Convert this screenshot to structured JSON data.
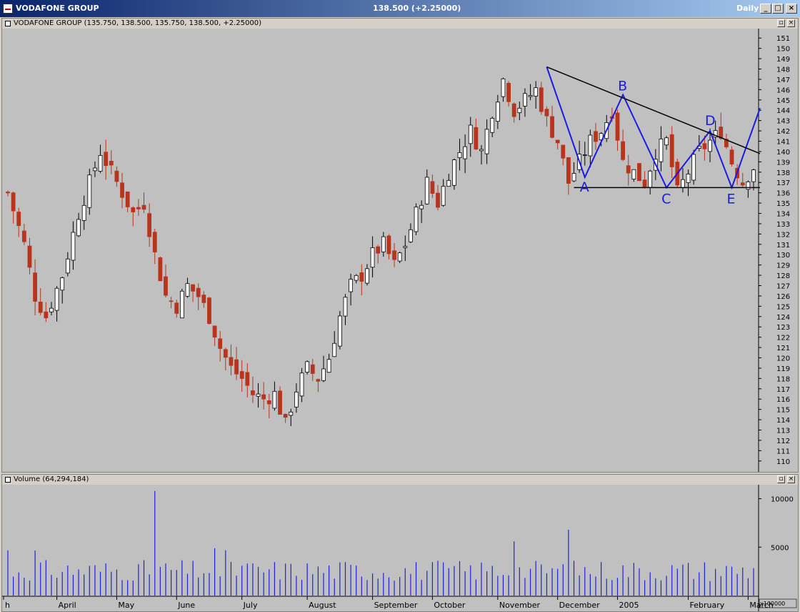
{
  "window": {
    "title": "VODAFONE GROUP",
    "quote": "138.500 (+2.25000)",
    "period": "Daily"
  },
  "price_pane": {
    "title": "VODAFONE GROUP (135.750, 138.500, 135.750, 138.500, +2.25000)"
  },
  "volume_pane": {
    "title": "Volume (64,294,184)",
    "multiplier": "x100000"
  },
  "chart_data": {
    "type": "candlestick",
    "y_axis_ticks": [
      "151",
      "150",
      "149",
      "148",
      "147",
      "146",
      "145",
      "144",
      "143",
      "142",
      "141",
      "140",
      "139",
      "138",
      "137",
      "136",
      "135",
      "134",
      "133",
      "132",
      "131",
      "130",
      "129",
      "128",
      "127",
      "126",
      "125",
      "124",
      "123",
      "122",
      "121",
      "120",
      "119",
      "118",
      "117",
      "116",
      "115",
      "114",
      "113",
      "112",
      "111",
      "110"
    ],
    "ylim": [
      109.5,
      151.5
    ],
    "month_labels": [
      "h",
      "April",
      "May",
      "June",
      "July",
      "August",
      "September",
      "October",
      "November",
      "December",
      "2005",
      "February",
      "March"
    ],
    "close_trend": [
      [
        0,
        136
      ],
      [
        3,
        131
      ],
      [
        5,
        126
      ],
      [
        7,
        124
      ],
      [
        10,
        128
      ],
      [
        13,
        134
      ],
      [
        15,
        137
      ],
      [
        17,
        140
      ],
      [
        19,
        138
      ],
      [
        21,
        136
      ],
      [
        23,
        134
      ],
      [
        25,
        135
      ],
      [
        27,
        130
      ],
      [
        29,
        126
      ],
      [
        31,
        125
      ],
      [
        33,
        127
      ],
      [
        35,
        126
      ],
      [
        37,
        124
      ],
      [
        39,
        121
      ],
      [
        41,
        119
      ],
      [
        43,
        118
      ],
      [
        45,
        116.5
      ],
      [
        47,
        116
      ],
      [
        49,
        116.5
      ],
      [
        51,
        113.5
      ],
      [
        53,
        117
      ],
      [
        55,
        119
      ],
      [
        57,
        118
      ],
      [
        59,
        120
      ],
      [
        61,
        124
      ],
      [
        63,
        127
      ],
      [
        65,
        128
      ],
      [
        67,
        130
      ],
      [
        69,
        131
      ],
      [
        71,
        129
      ],
      [
        73,
        131
      ],
      [
        75,
        134
      ],
      [
        77,
        137
      ],
      [
        79,
        135
      ],
      [
        81,
        138
      ],
      [
        83,
        140
      ],
      [
        85,
        142
      ],
      [
        87,
        140
      ],
      [
        89,
        144
      ],
      [
        91,
        147
      ],
      [
        93,
        144
      ],
      [
        95,
        145
      ],
      [
        97,
        146
      ],
      [
        99,
        143
      ],
      [
        101,
        141
      ],
      [
        103,
        137
      ],
      [
        105,
        139
      ],
      [
        107,
        141
      ],
      [
        109,
        142
      ],
      [
        111,
        144
      ],
      [
        113,
        139
      ],
      [
        115,
        138
      ],
      [
        117,
        137
      ],
      [
        119,
        140
      ],
      [
        121,
        141
      ],
      [
        123,
        136
      ],
      [
        125,
        138
      ],
      [
        127,
        140
      ],
      [
        129,
        141
      ],
      [
        131,
        142
      ],
      [
        133,
        139
      ],
      [
        135,
        137
      ],
      [
        137,
        138.5
      ]
    ],
    "pattern_points": {
      "A": 137.5,
      "B": 145.5,
      "C": 136.5,
      "D": 142,
      "E": 136.5
    },
    "pattern_labels": [
      "A",
      "B",
      "C",
      "D",
      "E"
    ],
    "volume_axis_ticks": [
      "10000",
      "5000"
    ],
    "volume_ylim": [
      0,
      11000
    ]
  },
  "colors": {
    "background": "#c0c0c0",
    "up_candle": "#ffffff",
    "down_candle": "#b8341c",
    "outline": "#000000",
    "pattern_line": "#1a1ae6",
    "trend_line": "#000000",
    "volume_bar": "#2020e0"
  }
}
